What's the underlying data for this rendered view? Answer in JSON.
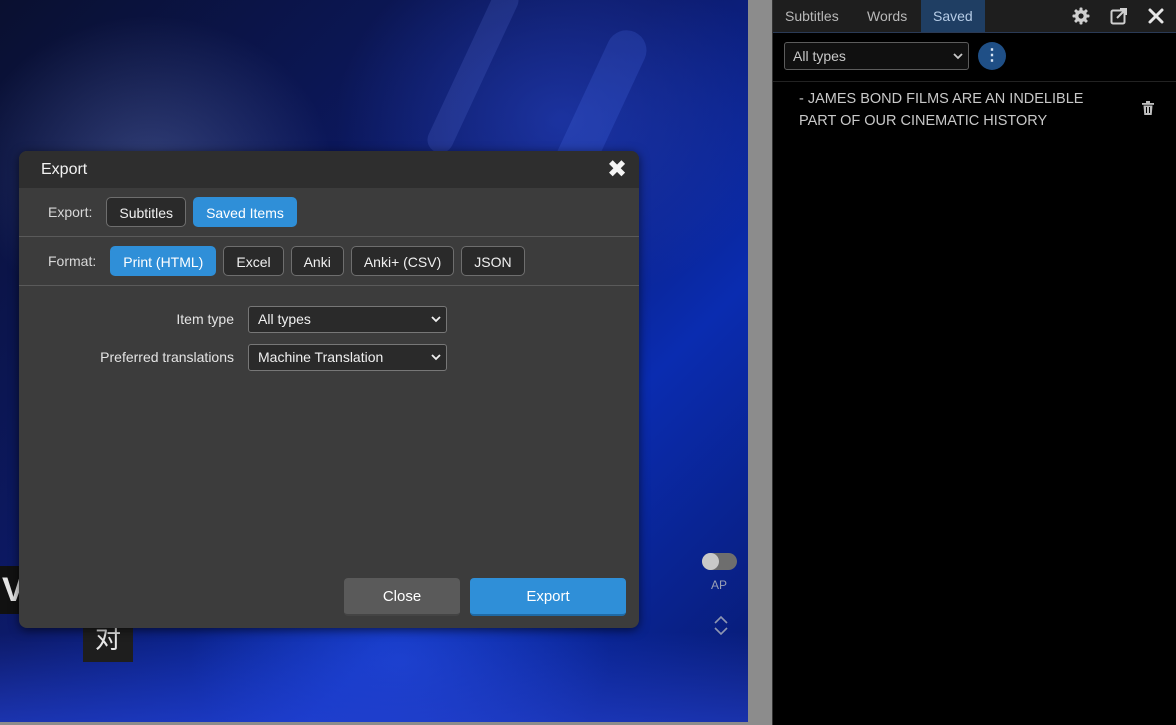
{
  "video": {
    "partial_caption_char": "V",
    "cjk_char": "对",
    "ap_label": "AP",
    "ap_enabled": false
  },
  "dialog": {
    "title": "Export",
    "close_glyph": "✖",
    "export_row": {
      "label": "Export:",
      "options": [
        "Subtitles",
        "Saved Items"
      ],
      "selected": "Saved Items"
    },
    "format_row": {
      "label": "Format:",
      "options": [
        "Print (HTML)",
        "Excel",
        "Anki",
        "Anki+ (CSV)",
        "JSON"
      ],
      "selected": "Print (HTML)"
    },
    "fields": {
      "item_type_label": "Item type",
      "item_type_value": "All types",
      "preferred_translations_label": "Preferred translations",
      "preferred_translations_value": "Machine Translation"
    },
    "buttons": {
      "close": "Close",
      "export": "Export"
    }
  },
  "panel": {
    "tabs": [
      "Subtitles",
      "Words",
      "Saved"
    ],
    "active_tab": "Saved",
    "filter_value": "All types",
    "more_glyph": "⋮",
    "saved_items": [
      {
        "text": "- JAMES BOND FILMS ARE AN INDELIBLE PART OF OUR CINEMATIC HISTORY"
      }
    ],
    "icons": [
      "gear-icon",
      "external-open-icon",
      "close-icon",
      "trash-icon"
    ]
  },
  "colors": {
    "accent": "#2f8fd8",
    "dialog_bg": "#3c3c3c",
    "panel_bg": "#000000",
    "active_tab_bg": "#1f3e63"
  }
}
